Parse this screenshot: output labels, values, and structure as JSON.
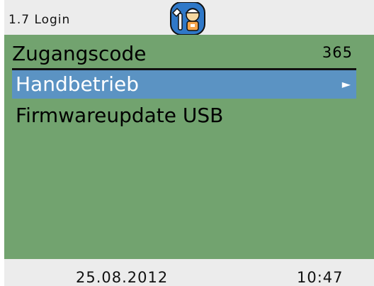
{
  "header": {
    "title": "1.7 Login",
    "icon": "technician-icon"
  },
  "access_code": {
    "label": "Zugangscode",
    "value": "365"
  },
  "menu": {
    "items": [
      {
        "label": "Handbetrieb",
        "selected": true,
        "arrow": "►"
      },
      {
        "label": "Firmwareupdate USB",
        "selected": false
      }
    ]
  },
  "footer": {
    "date": "25.08.2012",
    "time": "10:47"
  },
  "colors": {
    "main_background": "#72a36f",
    "header_background": "#ececec",
    "selection": "#5b93c3",
    "icon_accent": "#2f78c8"
  }
}
